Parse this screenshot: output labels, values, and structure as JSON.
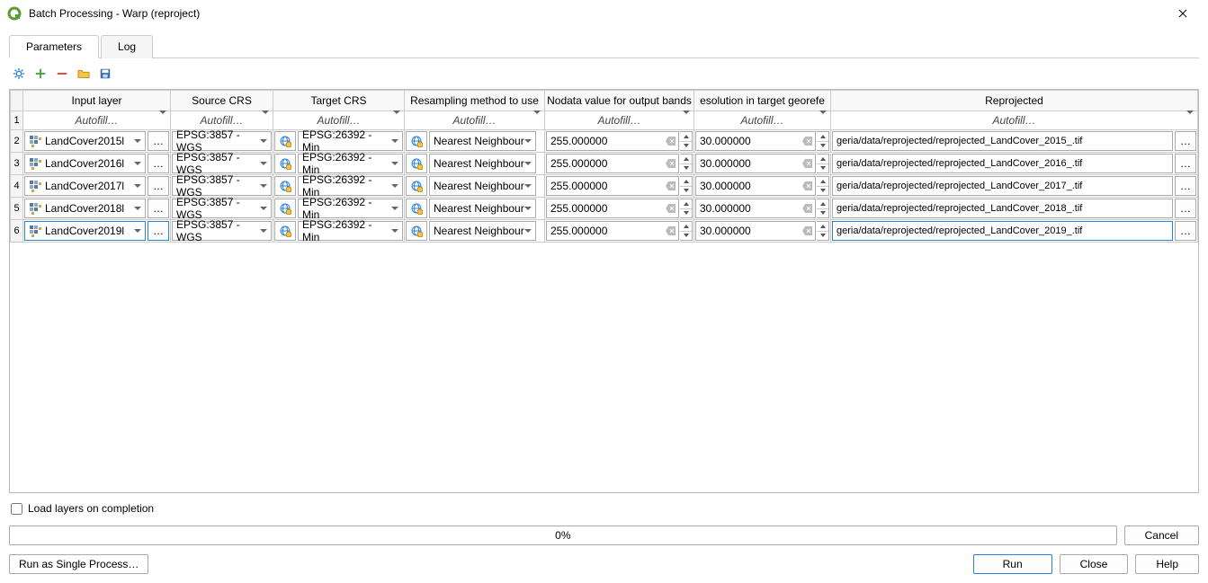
{
  "window": {
    "title": "Batch Processing - Warp (reproject)"
  },
  "tabs": {
    "parameters": "Parameters",
    "log": "Log"
  },
  "headers": {
    "input": "Input layer",
    "source_crs": "Source CRS",
    "target_crs": "Target CRS",
    "resampling": "Resampling method to use",
    "nodata": "Nodata value for output bands",
    "resolution": "esolution in target georefe",
    "reprojected": "Reprojected"
  },
  "autofill_label": "Autofill…",
  "browse_label": "…",
  "rows": [
    {
      "n": "2",
      "layer": "LandCover2015l",
      "src": "EPSG:3857 - WGS",
      "tgt": "EPSG:26392 - Min",
      "resample": "Nearest Neighbour",
      "nodata": "255.000000",
      "resol": "30.000000",
      "out": "geria/data/reprojected/reprojected_LandCover_2015_.tif"
    },
    {
      "n": "3",
      "layer": "LandCover2016l",
      "src": "EPSG:3857 - WGS",
      "tgt": "EPSG:26392 - Min",
      "resample": "Nearest Neighbour",
      "nodata": "255.000000",
      "resol": "30.000000",
      "out": "geria/data/reprojected/reprojected_LandCover_2016_.tif"
    },
    {
      "n": "4",
      "layer": "LandCover2017l",
      "src": "EPSG:3857 - WGS",
      "tgt": "EPSG:26392 - Min",
      "resample": "Nearest Neighbour",
      "nodata": "255.000000",
      "resol": "30.000000",
      "out": "geria/data/reprojected/reprojected_LandCover_2017_.tif"
    },
    {
      "n": "5",
      "layer": "LandCover2018l",
      "src": "EPSG:3857 - WGS",
      "tgt": "EPSG:26392 - Min",
      "resample": "Nearest Neighbour",
      "nodata": "255.000000",
      "resol": "30.000000",
      "out": "geria/data/reprojected/reprojected_LandCover_2018_.tif"
    },
    {
      "n": "6",
      "layer": "LandCover2019l",
      "src": "EPSG:3857 - WGS",
      "tgt": "EPSG:26392 - Min",
      "resample": "Nearest Neighbour",
      "nodata": "255.000000",
      "resol": "30.000000",
      "out": "geria/data/reprojected/reprojected_LandCover_2019_.tif"
    }
  ],
  "footer": {
    "load_layers": "Load layers on completion",
    "progress": "0%",
    "cancel": "Cancel",
    "run_single": "Run as Single Process…",
    "run": "Run",
    "close": "Close",
    "help": "Help"
  }
}
